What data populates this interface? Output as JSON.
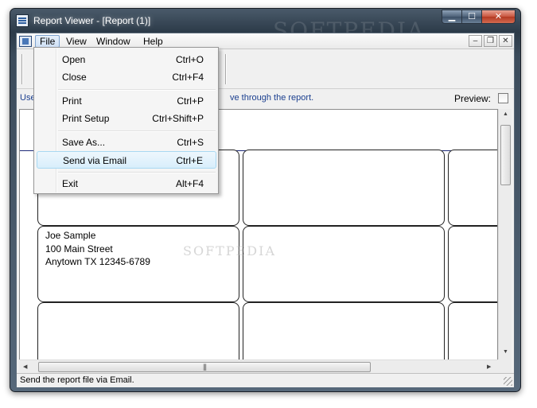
{
  "window": {
    "title": "Report Viewer - [Report (1)]",
    "watermark": "SOFTPEDIA",
    "buttons": {
      "minimize": "▁",
      "maximize": "☐",
      "close": "✕"
    }
  },
  "menubar": {
    "items": [
      "File",
      "View",
      "Window",
      "Help"
    ],
    "active": "File",
    "mdi_buttons": {
      "minimize": "–",
      "restore": "❐",
      "close": "✕"
    }
  },
  "info": {
    "text_start": "Use",
    "text_end": "ve through the report.",
    "preview_label": "Preview:",
    "preview_checked": false
  },
  "file_menu": {
    "items": [
      {
        "label": "Open",
        "shortcut": "Ctrl+O"
      },
      {
        "label": "Close",
        "shortcut": "Ctrl+F4"
      },
      {
        "label": "Print",
        "shortcut": "Ctrl+P"
      },
      {
        "label": "Print Setup",
        "shortcut": "Ctrl+Shift+P"
      },
      {
        "label": "Save As...",
        "shortcut": "Ctrl+S"
      },
      {
        "label": "Send via Email",
        "shortcut": "Ctrl+E",
        "highlighted": true
      },
      {
        "label": "Exit",
        "shortcut": "Alt+F4"
      }
    ]
  },
  "report": {
    "address_lines": [
      "Joe Sample",
      "100 Main Street",
      "Anytown TX 12345-6789"
    ],
    "watermark": "SOFTPEDIA"
  },
  "statusbar": {
    "text": "Send the report file via Email."
  },
  "colors": {
    "highlight_border": "#a8d8f2",
    "info_text": "#1b3f8f",
    "report_rule": "#1d2a78"
  }
}
